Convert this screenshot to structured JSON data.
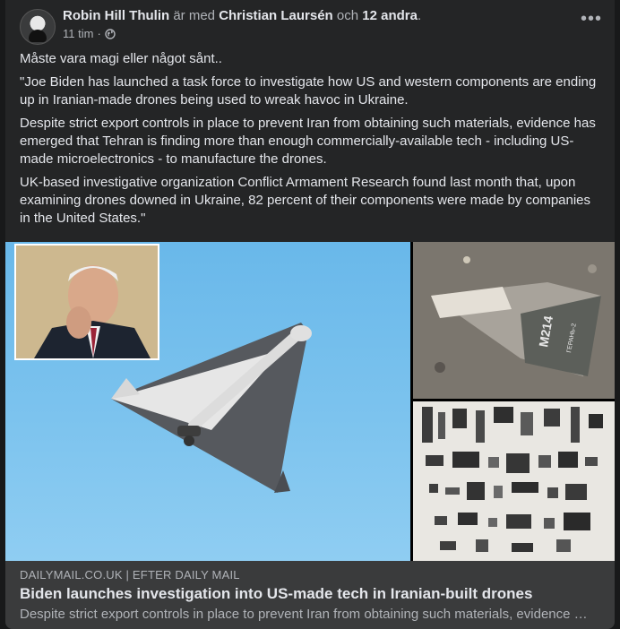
{
  "post": {
    "author": "Robin Hill Thulin",
    "with_text": "är med",
    "tagged": "Christian Laursén",
    "and_text": "och",
    "others": "12 andra",
    "trailing": ".",
    "time": "11 tim",
    "separator": "·",
    "privacy_icon": "globe-icon",
    "more_icon": "more-options-icon",
    "more_label": "•••"
  },
  "body": {
    "paragraphs": [
      "Måste vara magi eller något sånt..",
      "\"Joe Biden has launched a task force to investigate how US and western components are ending up in Iranian-made drones being used to wreak havoc in Ukraine.",
      "Despite strict export controls in place to prevent Iran from obtaining such materials, evidence has emerged that Tehran is finding more than enough commercially-available tech - including US-made microelectronics - to manufacture the drones.",
      "UK-based investigative organization Conflict Armament Research found last month that, upon examining drones downed in Ukraine, 82 percent of their components were made by companies in the United States.\""
    ]
  },
  "image": {
    "drone_marking": "M214",
    "drone_marking_small": "ГЕРАНЬ-2"
  },
  "link": {
    "domain": "DAILYMAIL.CO.UK | EFTER DAILY MAIL",
    "title": "Biden launches investigation into US-made tech in Iranian-built drones",
    "description": "Despite strict export controls in place to prevent Iran from obtaining such materials, evidence has emerged that Tehran is finding more than enough commercially-available tech"
  },
  "colors": {
    "background": "#18191a",
    "card": "#242526",
    "link_bar": "#3a3b3c",
    "text": "#e4e6eb",
    "secondary": "#b0b3b8"
  }
}
